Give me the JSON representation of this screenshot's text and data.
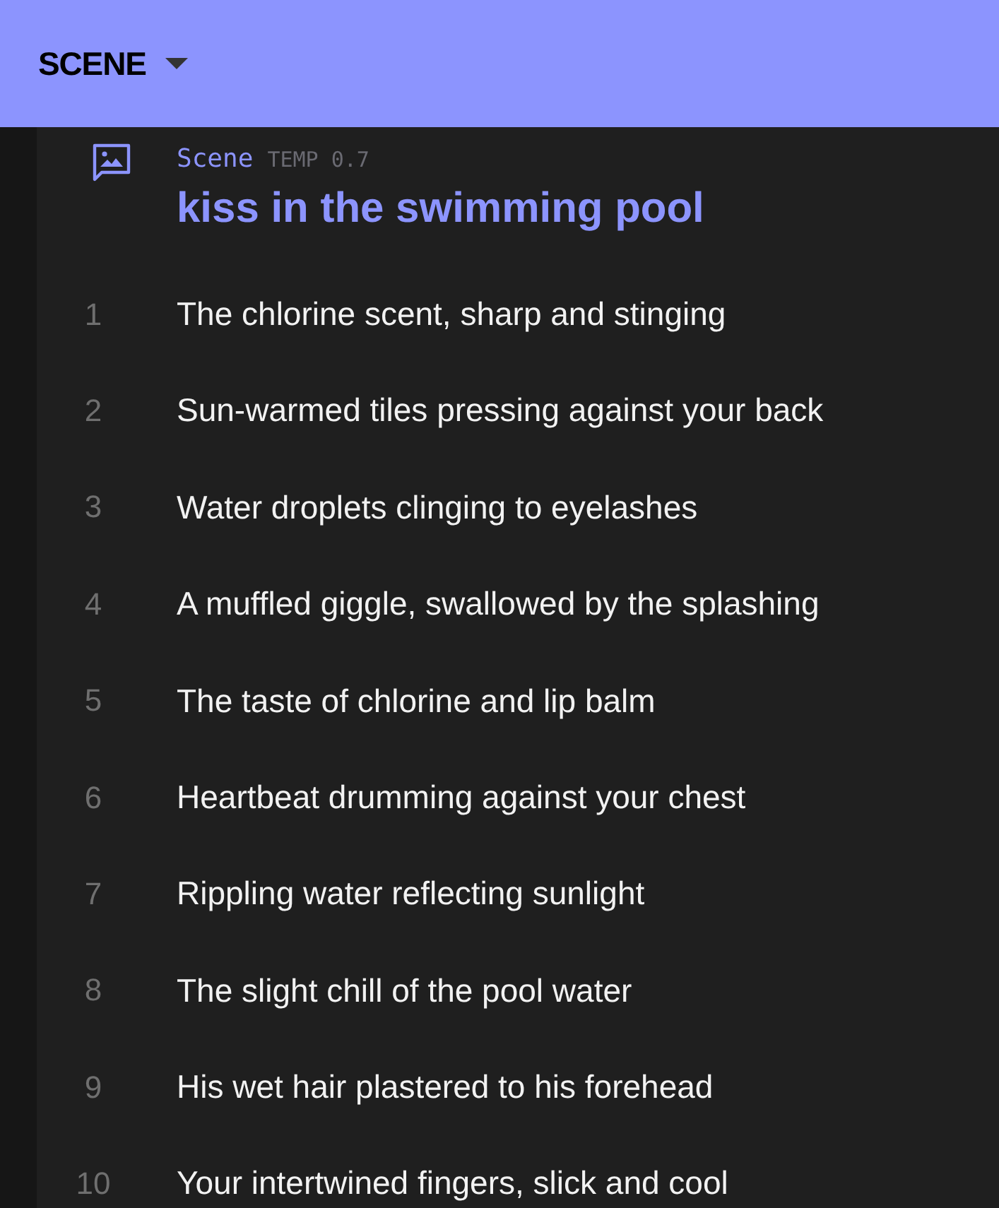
{
  "header": {
    "title": "SCENE"
  },
  "scene": {
    "label": "Scene",
    "temp": "TEMP 0.7",
    "title": "kiss in the swimming pool",
    "lines": [
      {
        "number": "1",
        "text": "The chlorine scent, sharp and stinging"
      },
      {
        "number": "2",
        "text": "Sun-warmed tiles pressing against your back"
      },
      {
        "number": "3",
        "text": "Water droplets clinging to eyelashes"
      },
      {
        "number": "4",
        "text": "A muffled giggle, swallowed by the splashing"
      },
      {
        "number": "5",
        "text": "The taste of chlorine and lip balm"
      },
      {
        "number": "6",
        "text": "Heartbeat drumming against your chest"
      },
      {
        "number": "7",
        "text": "Rippling water reflecting sunlight"
      },
      {
        "number": "8",
        "text": "The slight chill of the pool water"
      },
      {
        "number": "9",
        "text": "His wet hair plastered to his forehead"
      },
      {
        "number": "10",
        "text": "Your intertwined fingers, slick and cool"
      }
    ]
  }
}
